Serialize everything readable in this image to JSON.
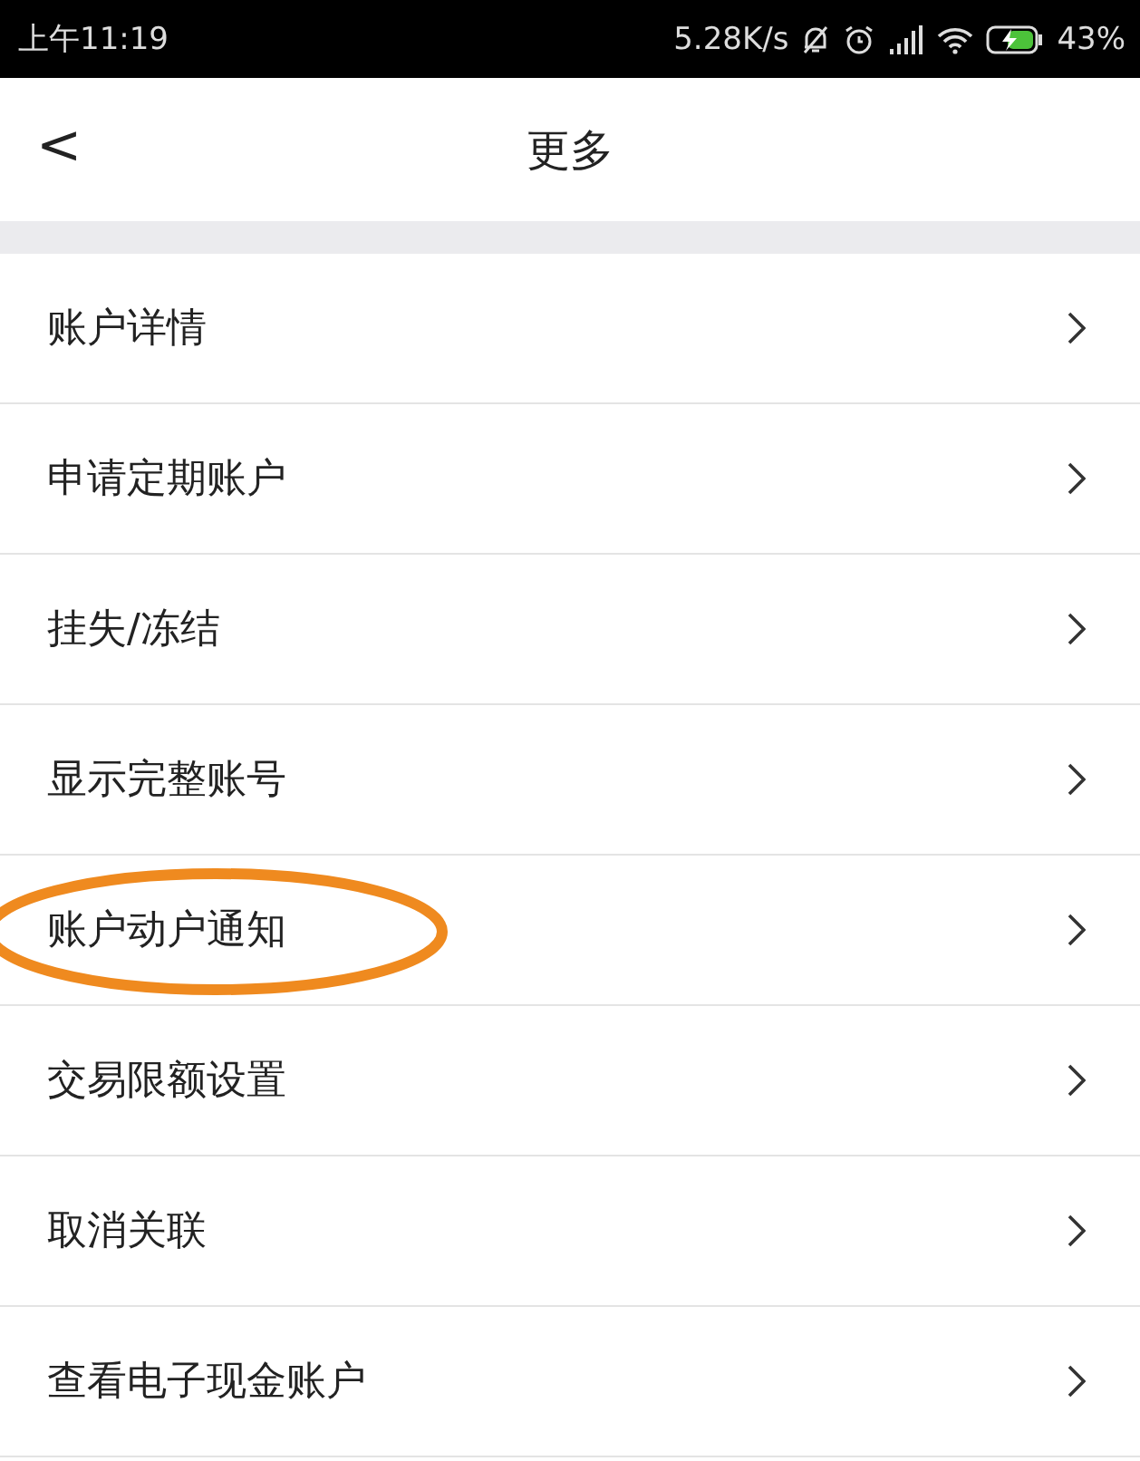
{
  "status_bar": {
    "time": "上午11:19",
    "network_speed": "5.28K/s",
    "battery": "43%"
  },
  "nav": {
    "back": "<",
    "title": "更多"
  },
  "items": [
    {
      "label": "账户详情",
      "circled": false
    },
    {
      "label": "申请定期账户",
      "circled": false
    },
    {
      "label": "挂失/冻结",
      "circled": false
    },
    {
      "label": "显示完整账号",
      "circled": false
    },
    {
      "label": "账户动户通知",
      "circled": true
    },
    {
      "label": "交易限额设置",
      "circled": false
    },
    {
      "label": "取消关联",
      "circled": false
    },
    {
      "label": "查看电子现金账户",
      "circled": false
    }
  ]
}
